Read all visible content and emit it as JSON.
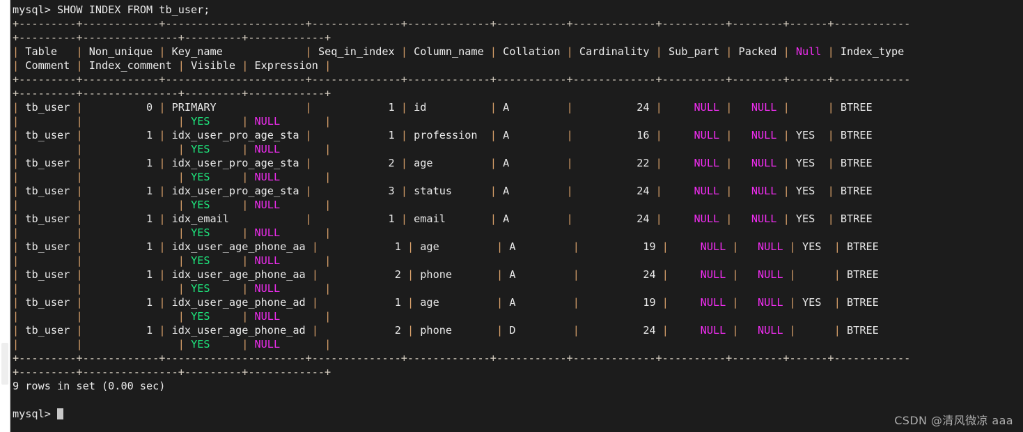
{
  "terminal": {
    "prompt": "mysql> ",
    "command": "SHOW INDEX FROM tb_user;",
    "result_line": "9 rows in set (0.00 sec)",
    "final_prompt": "mysql> ",
    "cursor_visible": true,
    "colors": {
      "background": "#1c1c1c",
      "text": "#e9e9e9",
      "separator": "#d8cfc2",
      "pipe": "#d8a06a",
      "null_value": "#f12df1",
      "yes_value": "#1ee67c",
      "cursor": "#c8c8c8"
    }
  },
  "table": {
    "columns": [
      "Table",
      "Non_unique",
      "Key_name",
      "Seq_in_index",
      "Column_name",
      "Collation",
      "Cardinality",
      "Sub_part",
      "Packed",
      "Null",
      "Index_type",
      "Comment",
      "Index_comment",
      "Visible",
      "Expression"
    ],
    "null_colored_headers": [
      "Null"
    ],
    "rows": [
      {
        "Table": "tb_user",
        "Non_unique": "0",
        "Key_name": "PRIMARY",
        "Seq_in_index": "1",
        "Column_name": "id",
        "Collation": "A",
        "Cardinality": "24",
        "Sub_part": "NULL",
        "Packed": "NULL",
        "Null": "",
        "Index_type": "BTREE",
        "Comment": "",
        "Index_comment": "",
        "Visible": "YES",
        "Expression": "NULL"
      },
      {
        "Table": "tb_user",
        "Non_unique": "1",
        "Key_name": "idx_user_pro_age_sta",
        "Seq_in_index": "1",
        "Column_name": "profession",
        "Collation": "A",
        "Cardinality": "16",
        "Sub_part": "NULL",
        "Packed": "NULL",
        "Null": "YES",
        "Index_type": "BTREE",
        "Comment": "",
        "Index_comment": "",
        "Visible": "YES",
        "Expression": "NULL"
      },
      {
        "Table": "tb_user",
        "Non_unique": "1",
        "Key_name": "idx_user_pro_age_sta",
        "Seq_in_index": "2",
        "Column_name": "age",
        "Collation": "A",
        "Cardinality": "22",
        "Sub_part": "NULL",
        "Packed": "NULL",
        "Null": "YES",
        "Index_type": "BTREE",
        "Comment": "",
        "Index_comment": "",
        "Visible": "YES",
        "Expression": "NULL"
      },
      {
        "Table": "tb_user",
        "Non_unique": "1",
        "Key_name": "idx_user_pro_age_sta",
        "Seq_in_index": "3",
        "Column_name": "status",
        "Collation": "A",
        "Cardinality": "24",
        "Sub_part": "NULL",
        "Packed": "NULL",
        "Null": "YES",
        "Index_type": "BTREE",
        "Comment": "",
        "Index_comment": "",
        "Visible": "YES",
        "Expression": "NULL"
      },
      {
        "Table": "tb_user",
        "Non_unique": "1",
        "Key_name": "idx_email",
        "Seq_in_index": "1",
        "Column_name": "email",
        "Collation": "A",
        "Cardinality": "24",
        "Sub_part": "NULL",
        "Packed": "NULL",
        "Null": "YES",
        "Index_type": "BTREE",
        "Comment": "",
        "Index_comment": "",
        "Visible": "YES",
        "Expression": "NULL"
      },
      {
        "Table": "tb_user",
        "Non_unique": "1",
        "Key_name": "idx_user_age_phone_aa",
        "Seq_in_index": "1",
        "Column_name": "age",
        "Collation": "A",
        "Cardinality": "19",
        "Sub_part": "NULL",
        "Packed": "NULL",
        "Null": "YES",
        "Index_type": "BTREE",
        "Comment": "",
        "Index_comment": "",
        "Visible": "YES",
        "Expression": "NULL"
      },
      {
        "Table": "tb_user",
        "Non_unique": "1",
        "Key_name": "idx_user_age_phone_aa",
        "Seq_in_index": "2",
        "Column_name": "phone",
        "Collation": "A",
        "Cardinality": "24",
        "Sub_part": "NULL",
        "Packed": "NULL",
        "Null": "",
        "Index_type": "BTREE",
        "Comment": "",
        "Index_comment": "",
        "Visible": "YES",
        "Expression": "NULL"
      },
      {
        "Table": "tb_user",
        "Non_unique": "1",
        "Key_name": "idx_user_age_phone_ad",
        "Seq_in_index": "1",
        "Column_name": "age",
        "Collation": "A",
        "Cardinality": "19",
        "Sub_part": "NULL",
        "Packed": "NULL",
        "Null": "YES",
        "Index_type": "BTREE",
        "Comment": "",
        "Index_comment": "",
        "Visible": "YES",
        "Expression": "NULL"
      },
      {
        "Table": "tb_user",
        "Non_unique": "1",
        "Key_name": "idx_user_age_phone_ad",
        "Seq_in_index": "2",
        "Column_name": "phone",
        "Collation": "D",
        "Cardinality": "24",
        "Sub_part": "NULL",
        "Packed": "NULL",
        "Null": "",
        "Index_type": "BTREE",
        "Comment": "",
        "Index_comment": "",
        "Visible": "YES",
        "Expression": "NULL"
      }
    ]
  },
  "watermark": {
    "text": "CSDN @清风微凉 aaa"
  }
}
